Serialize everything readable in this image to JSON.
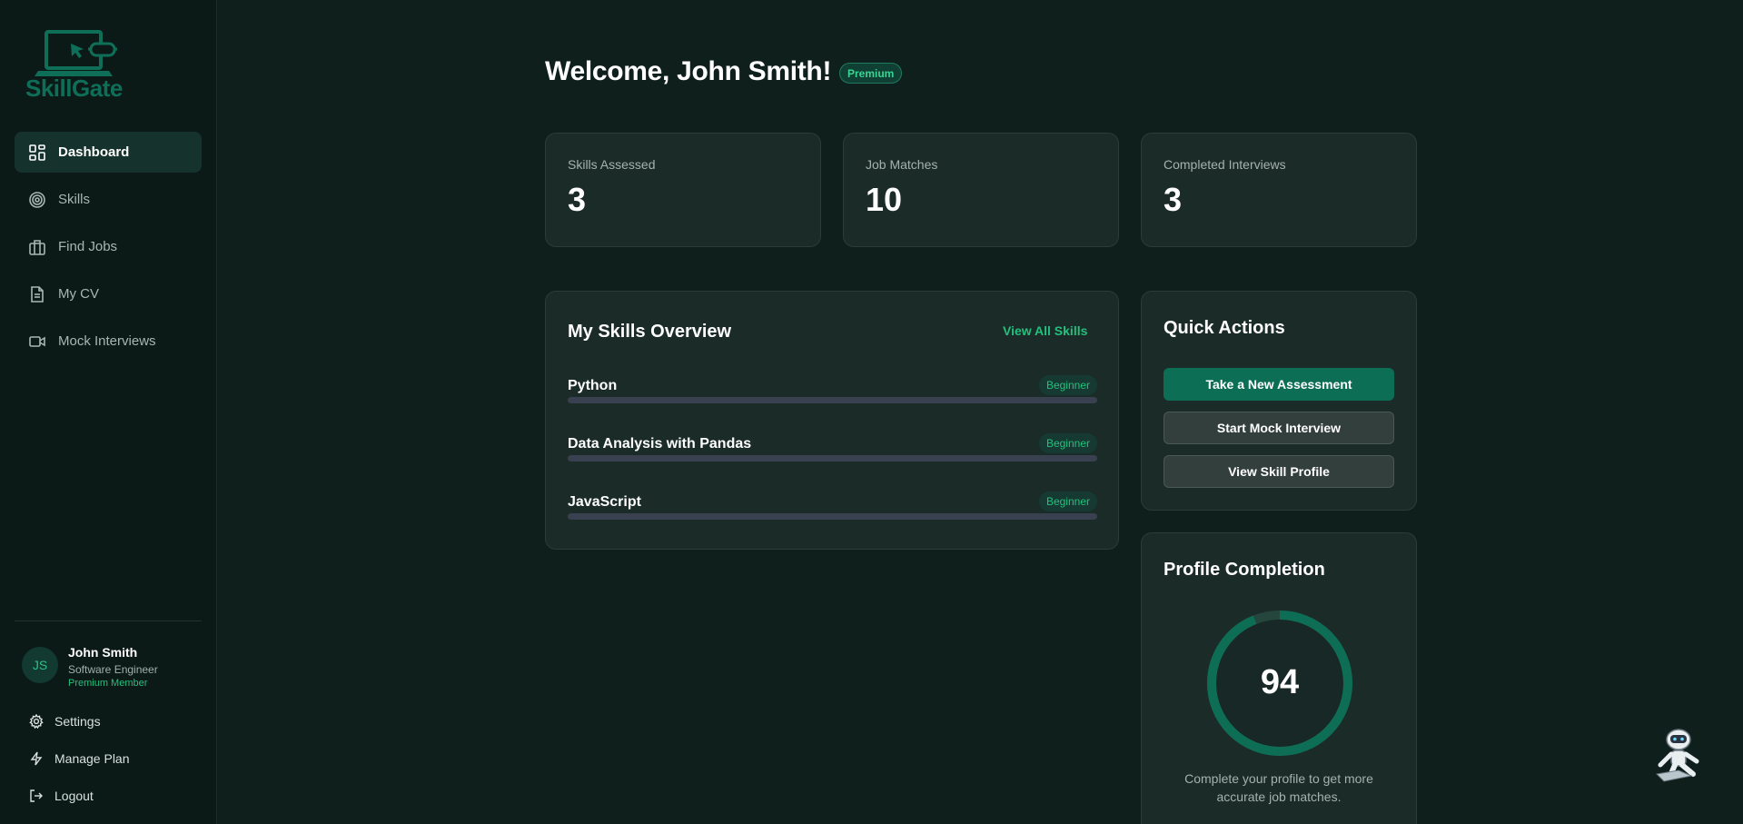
{
  "brand": {
    "name": "SkillGate",
    "color": "#0f6e58",
    "accent": "#23c07e"
  },
  "nav": {
    "items": [
      {
        "label": "Dashboard",
        "icon": "dashboard-icon",
        "active": true
      },
      {
        "label": "Skills",
        "icon": "target-icon",
        "active": false
      },
      {
        "label": "Find Jobs",
        "icon": "briefcase-icon",
        "active": false
      },
      {
        "label": "My CV",
        "icon": "document-icon",
        "active": false
      },
      {
        "label": "Mock Interviews",
        "icon": "video-icon",
        "active": false
      }
    ]
  },
  "user": {
    "initials": "JS",
    "name": "John Smith",
    "role": "Software Engineer",
    "plan": "Premium Member"
  },
  "bottom_links": {
    "settings": "Settings",
    "manage_plan": "Manage Plan",
    "logout": "Logout"
  },
  "header": {
    "welcome": "Welcome, John Smith!",
    "badge": "Premium"
  },
  "stats": [
    {
      "label": "Skills Assessed",
      "value": "3"
    },
    {
      "label": "Job Matches",
      "value": "10"
    },
    {
      "label": "Completed Interviews",
      "value": "3"
    }
  ],
  "skills_overview": {
    "title": "My Skills Overview",
    "view_all": "View All Skills",
    "skills": [
      {
        "name": "Python",
        "level": "Beginner",
        "progress": 0
      },
      {
        "name": "Data Analysis with Pandas",
        "level": "Beginner",
        "progress": 0
      },
      {
        "name": "JavaScript",
        "level": "Beginner",
        "progress": 0
      }
    ]
  },
  "quick_actions": {
    "title": "Quick Actions",
    "buttons": [
      "Take a New Assessment",
      "Start Mock Interview",
      "View Skill Profile"
    ]
  },
  "profile_completion": {
    "title": "Profile Completion",
    "value": "94",
    "percent": 94,
    "description": "Complete your profile to get more accurate job matches."
  }
}
